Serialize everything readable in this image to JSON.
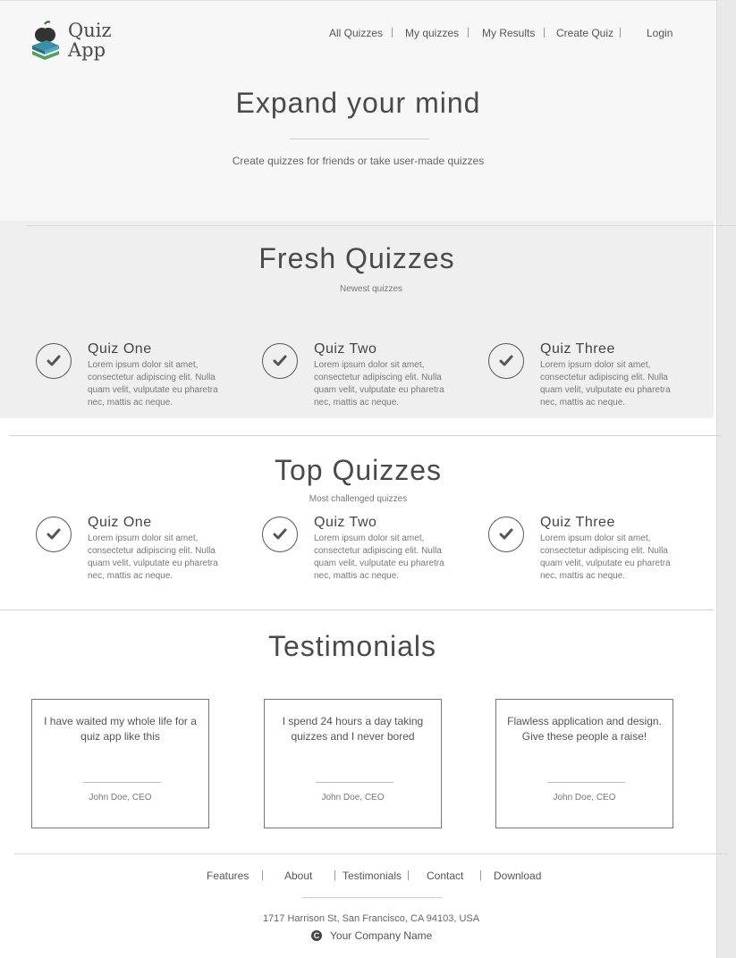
{
  "app": {
    "logo_line1": "Quiz",
    "logo_line2": "App",
    "logo_icon": "apple-books-icon"
  },
  "nav": {
    "items": [
      "All Quizzes",
      "My quizzes",
      "My Results",
      "Create Quiz",
      "Login"
    ]
  },
  "hero": {
    "title": "Expand your mind",
    "subtitle": "Create quizzes for friends or take user-made quizzes"
  },
  "fresh": {
    "title": "Fresh Quizzes",
    "subtitle": "Newest quizzes",
    "quizzes": [
      {
        "title": "Quiz One",
        "desc": "Lorem ipsum dolor sit amet, consectetur adipiscing elit. Nulla quam velit, vulputate eu pharetra nec, mattis ac neque."
      },
      {
        "title": "Quiz Two",
        "desc": "Lorem ipsum dolor sit amet, consectetur adipiscing elit. Nulla quam velit, vulputate eu pharetra nec, mattis ac neque."
      },
      {
        "title": "Quiz Three",
        "desc": "Lorem ipsum dolor sit amet, consectetur adipiscing elit. Nulla quam velit, vulputate eu pharetra nec, mattis ac neque."
      }
    ]
  },
  "top": {
    "title": "Top Quizzes",
    "subtitle": "Most challenged quizzes",
    "quizzes": [
      {
        "title": "Quiz One",
        "desc": "Lorem ipsum dolor sit amet, consectetur adipiscing elit. Nulla quam velit, vulputate eu pharetra nec, mattis ac neque."
      },
      {
        "title": "Quiz Two",
        "desc": "Lorem ipsum dolor sit amet, consectetur adipiscing elit. Nulla quam velit, vulputate eu pharetra nec, mattis ac neque."
      },
      {
        "title": "Quiz Three",
        "desc": "Lorem ipsum dolor sit amet, consectetur adipiscing elit. Nulla quam velit, vulputate eu pharetra nec, mattis ac neque."
      }
    ]
  },
  "testimonials": {
    "title": "Testimonials",
    "items": [
      {
        "quote": "I have waited my whole life for a quiz app like this",
        "author": "John Doe, CEO"
      },
      {
        "quote": "I spend 24 hours a day taking quizzes and I never bored",
        "author": "John Doe, CEO"
      },
      {
        "quote": "Flawless application and design. Give these people a raise!",
        "author": "John Doe, CEO"
      }
    ]
  },
  "footer": {
    "links": [
      "Features",
      "About",
      "Testimonials",
      "Contact",
      "Download"
    ],
    "address": "1717 Harrison St, San Francisco, CA 94103, USA",
    "company": "Your Company Name",
    "copyright_symbol": "C"
  },
  "colors": {
    "text": "#555555",
    "hero_bg": "#f7f7f7",
    "fresh_bg": "#efefef",
    "logo_apple": "#333333",
    "logo_books": "#4a9fb5"
  }
}
